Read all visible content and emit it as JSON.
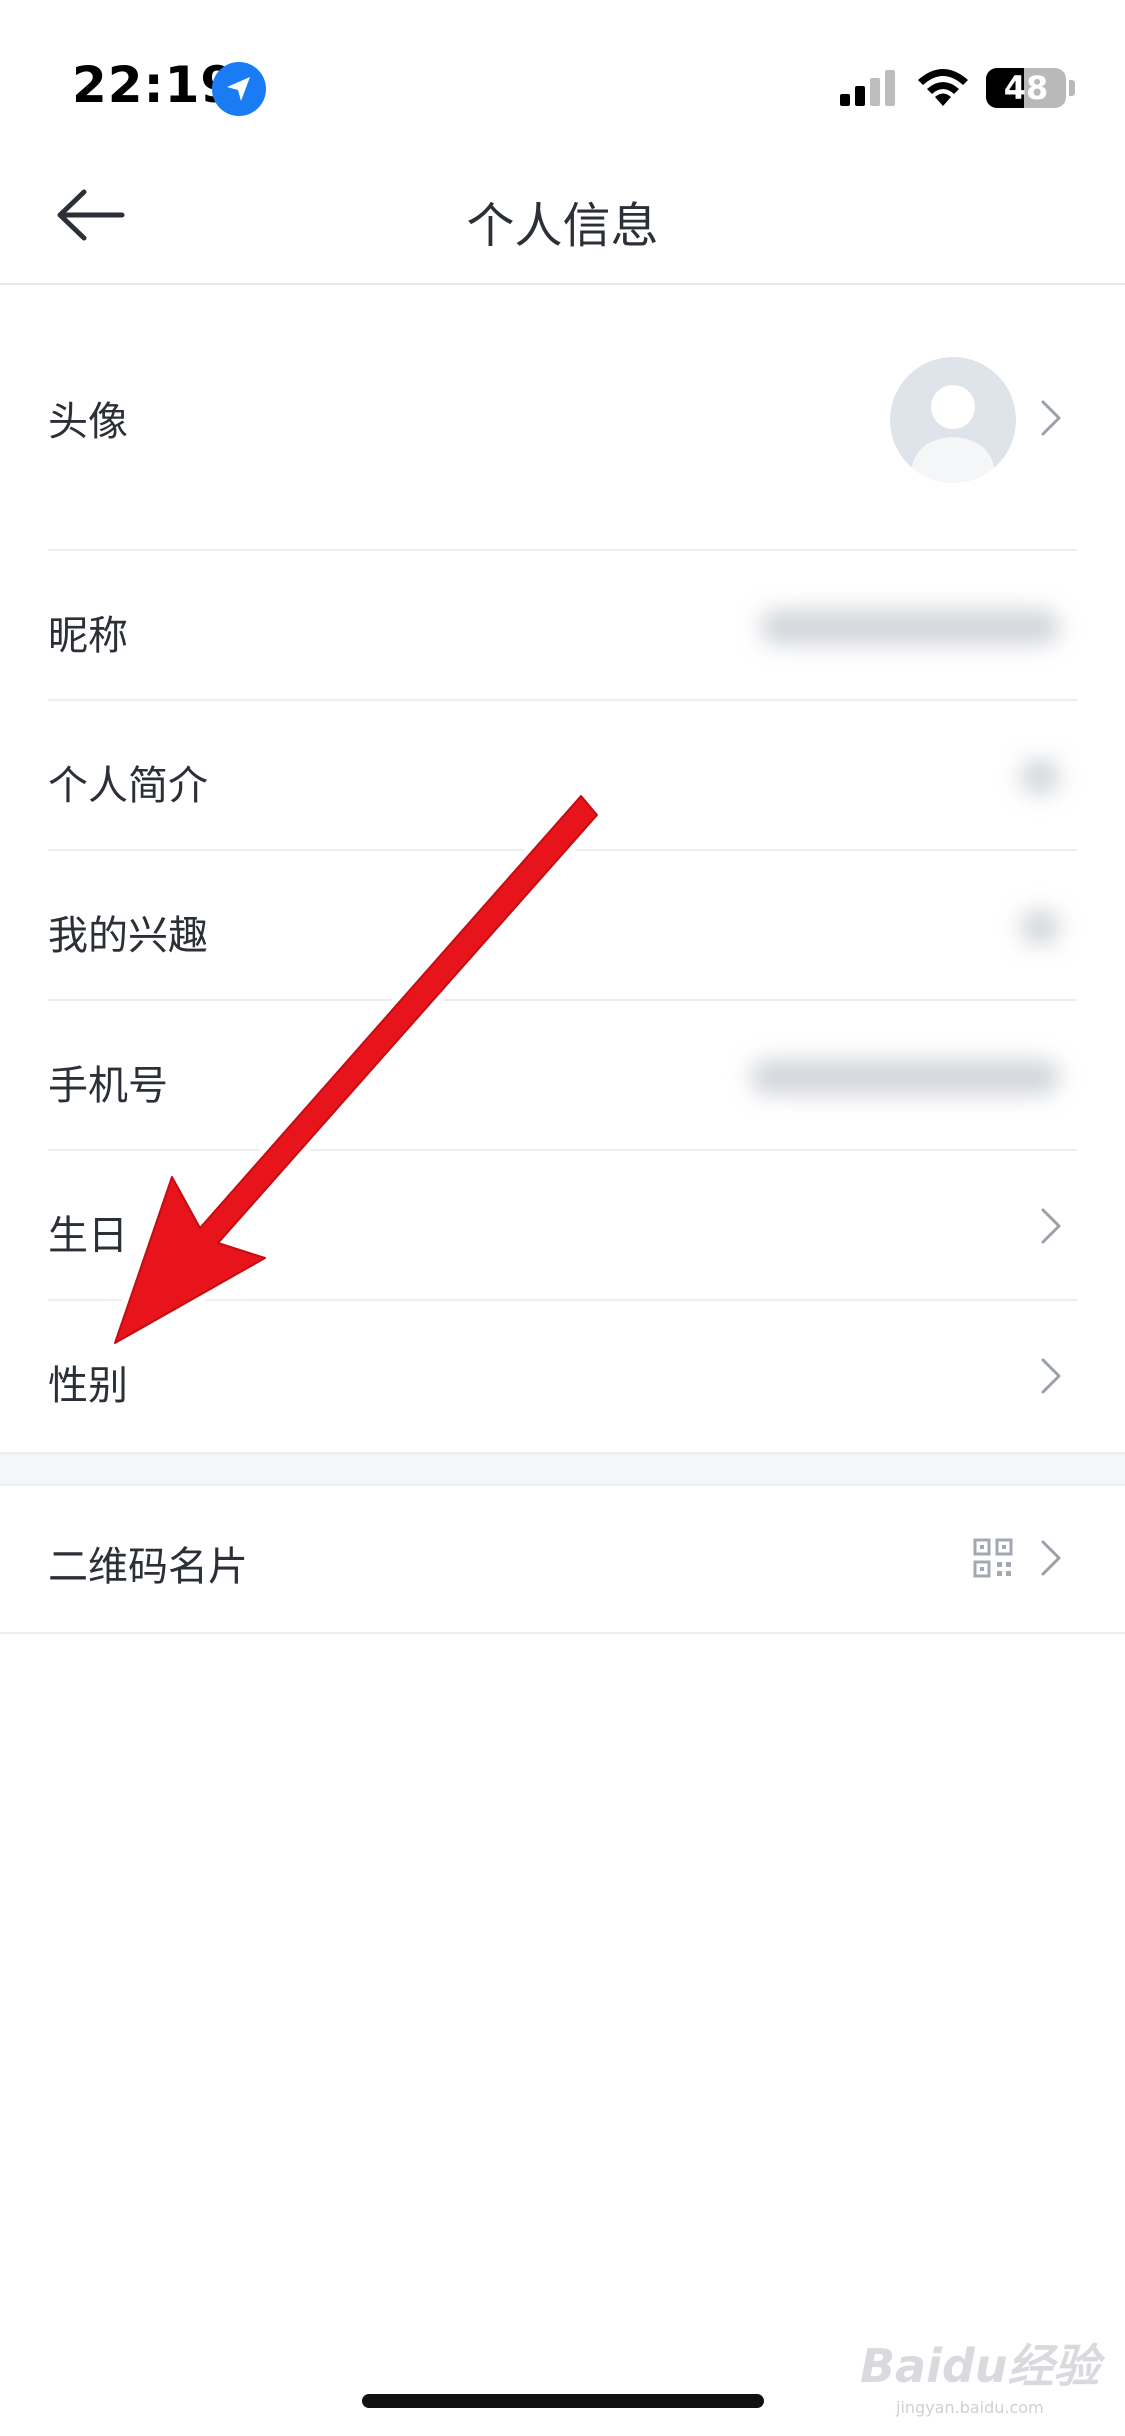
{
  "status_bar": {
    "time": "22:19",
    "battery": "48",
    "battery_level": 0.48,
    "icons": [
      "location-arrow-icon",
      "signal-icon",
      "wifi-icon",
      "battery-icon"
    ]
  },
  "nav": {
    "title": "个人信息",
    "back_icon": "arrow-left-icon"
  },
  "rows": [
    {
      "label": "头像",
      "trailing": "avatar",
      "chevron": true
    },
    {
      "label": "昵称",
      "trailing": "blurred-value"
    },
    {
      "label": "个人简介",
      "trailing": "blurred-value"
    },
    {
      "label": "我的兴趣",
      "trailing": "blurred-value"
    },
    {
      "label": "手机号",
      "trailing": "blurred-value"
    },
    {
      "label": "生日",
      "chevron": true
    },
    {
      "label": "性别",
      "chevron": true
    },
    {
      "label": "二维码名片",
      "trailing": "qr-code-icon",
      "chevron": true
    }
  ],
  "colors": {
    "annotation_arrow": "#e8141b",
    "location_badge": "#1a7cf5",
    "divider": "#eceef1",
    "section_gap": "#f5f6f8"
  },
  "watermark": {
    "brand": "Baidu经验",
    "sub": "jingyan.baidu.com"
  }
}
